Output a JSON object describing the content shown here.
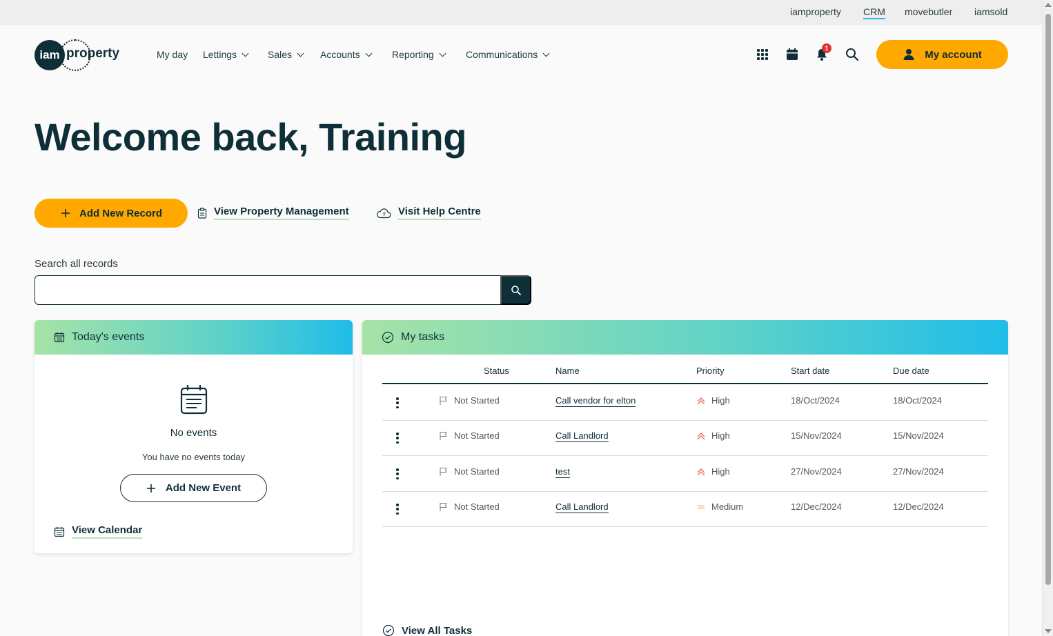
{
  "topbar": {
    "links": [
      "iamproperty",
      "CRM",
      "movebutler",
      "iamsold"
    ],
    "active": "CRM"
  },
  "header": {
    "logo_circle": "iam",
    "logo_word": "property",
    "nav": [
      "My day",
      "Lettings",
      "Sales",
      "Accounts",
      "Reporting",
      "Communications"
    ],
    "notification_count": "1",
    "account_label": "My account"
  },
  "welcome": "Welcome back, Training",
  "actions": {
    "add_record": "Add New Record",
    "view_pm": "View Property Management",
    "help": "Visit Help Centre"
  },
  "search": {
    "label": "Search all records",
    "value": ""
  },
  "events": {
    "title": "Today's events",
    "empty_title": "No events",
    "empty_sub": "You have no events today",
    "add_event": "Add New Event",
    "view_calendar": "View Calendar"
  },
  "tasks": {
    "title": "My tasks",
    "columns": [
      "Status",
      "Name",
      "Priority",
      "Start date",
      "Due date"
    ],
    "rows": [
      {
        "status": "Not Started",
        "name": "Call vendor for elton",
        "priority": "High",
        "start": "18/Oct/2024",
        "due": "18/Oct/2024"
      },
      {
        "status": "Not Started",
        "name": "Call Landlord",
        "priority": "High",
        "start": "15/Nov/2024",
        "due": "15/Nov/2024"
      },
      {
        "status": "Not Started",
        "name": "test",
        "priority": "High",
        "start": "27/Nov/2024",
        "due": "27/Nov/2024"
      },
      {
        "status": "Not Started",
        "name": "Call Landlord",
        "priority": "Medium",
        "start": "12/Dec/2024",
        "due": "12/Dec/2024"
      }
    ],
    "view_all": "View All Tasks"
  },
  "colors": {
    "brand_navy": "#0f2f38",
    "accent_orange": "#ffa800",
    "priority_high": "#e05a4a",
    "priority_medium": "#f0a020"
  }
}
